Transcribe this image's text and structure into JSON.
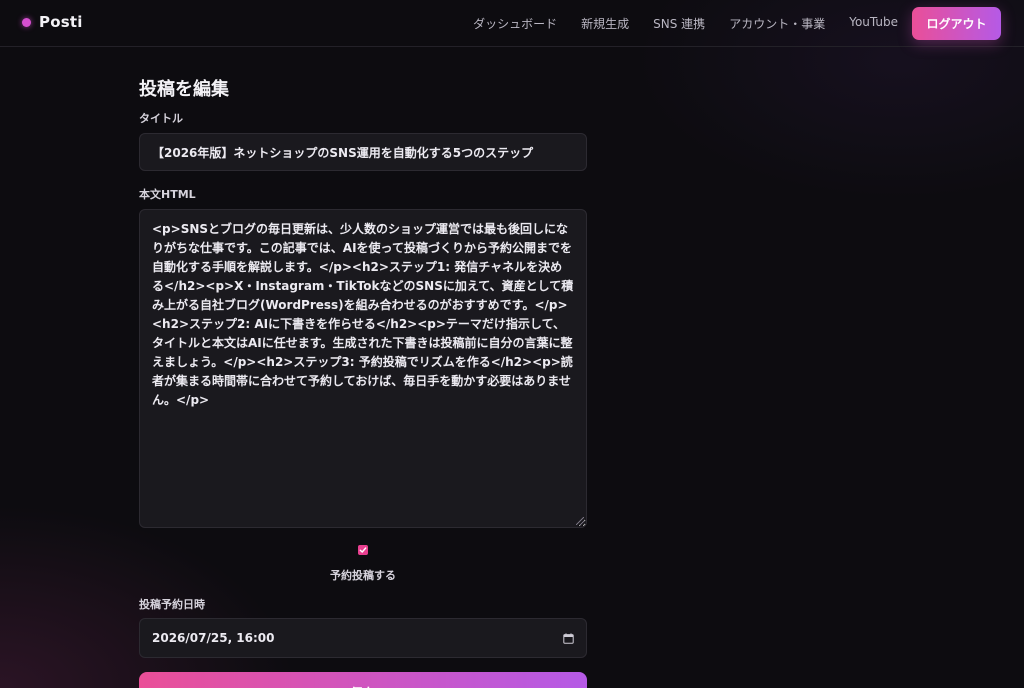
{
  "header": {
    "brand": "Posti",
    "nav": [
      "ダッシュボード",
      "新規生成",
      "SNS 連携",
      "アカウント・事業",
      "YouTube"
    ],
    "logout_label": "ログアウト"
  },
  "form": {
    "page_title": "投稿を編集",
    "title_label": "タイトル",
    "title_value": "【2026年版】ネットショップのSNS運用を自動化する5つのステップ",
    "body_label": "本文HTML",
    "body_value": "<p>SNSとブログの毎日更新は、少人数のショップ運営では最も後回しになりがちな仕事です。この記事では、AIを使って投稿づくりから予約公開までを自動化する手順を解説します。</p><h2>ステップ1: 発信チャネルを決める</h2><p>X・Instagram・TikTokなどのSNSに加えて、資産として積み上がる自社ブログ(WordPress)を組み合わせるのがおすすめです。</p><h2>ステップ2: AIに下書きを作らせる</h2><p>テーマだけ指示して、タイトルと本文はAIに任せます。生成された下書きは投稿前に自分の言葉に整えましょう。</p><h2>ステップ3: 予約投稿でリズムを作る</h2><p>読者が集まる時間帯に合わせて予約しておけば、毎日手を動かす必要はありません。</p>",
    "schedule_checkbox_label": "予約投稿する",
    "schedule_checked": true,
    "datetime_label": "投稿予約日時",
    "datetime_value": "2026/07/25, 16:00",
    "save_label": "保存"
  },
  "colors": {
    "accent_start": "#ea4f98",
    "accent_end": "#b55ae6",
    "background": "#0d0c10"
  }
}
